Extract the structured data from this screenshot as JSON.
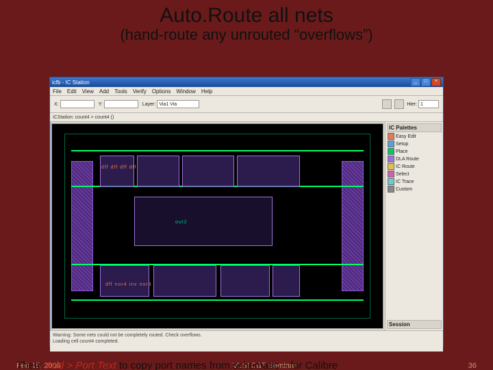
{
  "slide": {
    "title": "Auto.Route all nets",
    "subtitle": "(hand-route any unrouted “overflows”)",
    "footer_date": "Feb 15, 2006",
    "footer_center": "VLSI D&T Seminar",
    "footer_page": "36",
    "note_prefix": "Then:",
    "note_red": "Add > Port Text",
    "note_suffix": "to copy port names from schematic – for Calibre"
  },
  "app": {
    "window_title": "icfb - IC Station",
    "menus": [
      "File",
      "Edit",
      "View",
      "Add",
      "Tools",
      "Verify",
      "Options",
      "Window",
      "Help"
    ],
    "toolbar": {
      "x_label": "X:",
      "x_value": "",
      "y_label": "Y:",
      "y_value": "",
      "layer_label": "Layer:",
      "layer_value": "Via1 Via",
      "hier_label": "Hier:",
      "hier_value": "1"
    },
    "cell_path": "ICStation: count4 > count4 ()",
    "design": {
      "labels_top": "dff  dff  dff  dff",
      "labels_bottom": "dff  nor4  inv  nor3",
      "net_label": "out2"
    },
    "palette": {
      "header": "IC Palettes",
      "items": [
        "Easy Edit",
        "Setup",
        "Place",
        "DLA Route",
        "IC Route",
        "Select",
        "IC Trace",
        "Custom"
      ],
      "footer": "Session"
    },
    "log": [
      "Warning: Some nets could not be completely routed. Check overflows.",
      "Loading cell count4 completed."
    ]
  }
}
